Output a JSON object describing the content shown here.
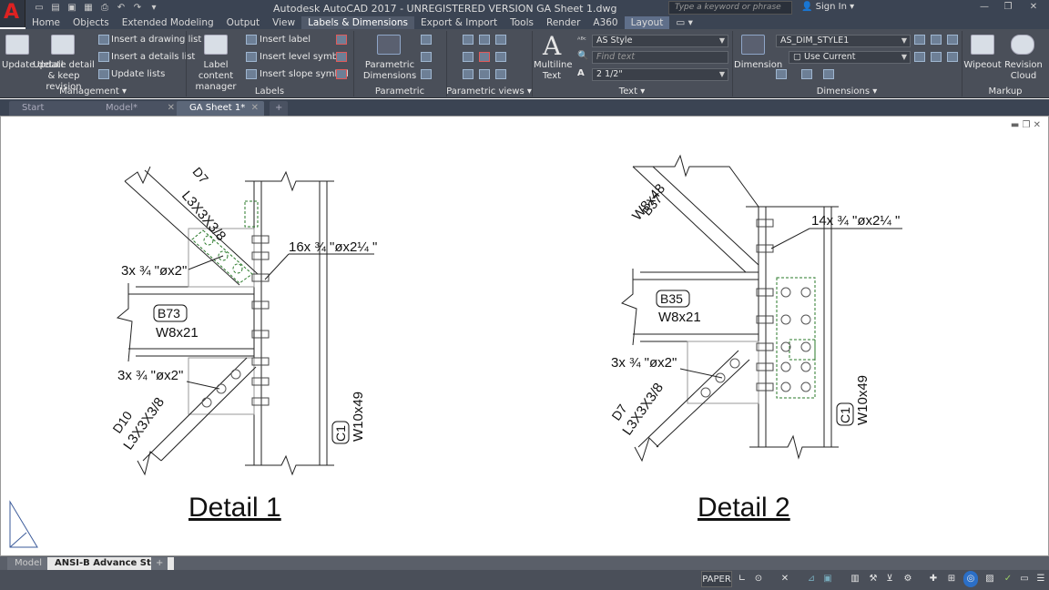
{
  "app": {
    "title": "Autodesk AutoCAD 2017 - UNREGISTERED VERSION    GA Sheet 1.dwg",
    "search_placeholder": "Type a keyword or phrase",
    "signin": "Sign In"
  },
  "menu_tabs": [
    "Home",
    "Objects",
    "Extended Modeling",
    "Output",
    "View",
    "Labels & Dimensions",
    "Export & Import",
    "Tools",
    "Render",
    "A360",
    "Layout"
  ],
  "ribbon": {
    "management": {
      "title": "Management",
      "update_detail": "Update detail",
      "update_detail_keep": "Update detail & keep revision",
      "insert_drawing_list": "Insert a drawing list",
      "insert_details_list": "Insert a details list",
      "update_lists": "Update lists"
    },
    "labels": {
      "title": "Labels",
      "label_content_manager": "Label content manager",
      "insert_label": "Insert label",
      "insert_level_symbol": "Insert level symbol",
      "insert_slope_symbol": "Insert slope symbol"
    },
    "parametric_dimensions": {
      "title": "Parametric Dimensions",
      "button": "Parametric Dimensions"
    },
    "parametric_views": {
      "title": "Parametric views"
    },
    "text": {
      "title": "Text",
      "multiline_text": "Multiline Text",
      "style": "AS Style",
      "find_placeholder": "Find text",
      "height": "2 1/2\""
    },
    "dimensions": {
      "title": "Dimensions",
      "dimension": "Dimension",
      "dim_style": "AS_DIM_STYLE1",
      "use_current": "Use Current"
    },
    "markup": {
      "title": "Markup",
      "wipeout": "Wipeout",
      "revision_cloud": "Revision Cloud"
    }
  },
  "doc_tabs": [
    "Start",
    "Model*",
    "GA Sheet 1*"
  ],
  "drawing": {
    "detail1": {
      "title": "Detail 1",
      "d7_tag": "D7",
      "d7_profile": "L3X3X3/8",
      "bolts_top": "16x ¾ \"øx2¼ \"",
      "bolts_d7": "3x ¾ \"øx2\"",
      "b73_tag": "B73",
      "b73_profile": "W8x21",
      "bolts_d10": "3x ¾ \"øx2\"",
      "d10_tag": "D10",
      "d10_profile": "L3X3X3/8",
      "c1_tag": "C1",
      "c1_profile": "W10x49"
    },
    "detail2": {
      "title": "Detail 2",
      "b37_tag": "B37",
      "b37_profile": "W8x48",
      "bolts_top": "14x ¾ \"øx2¼ \"",
      "b35_tag": "B35",
      "b35_profile": "W8x21",
      "bolts_d7": "3x ¾ \"øx2\"",
      "d7_tag": "D7",
      "d7_profile": "L3X3X3/8",
      "c1_tag": "C1",
      "c1_profile": "W10x49"
    }
  },
  "layout_tabs": [
    "Model",
    "ANSI-B Advance Steel"
  ],
  "status": {
    "space": "PAPER"
  }
}
